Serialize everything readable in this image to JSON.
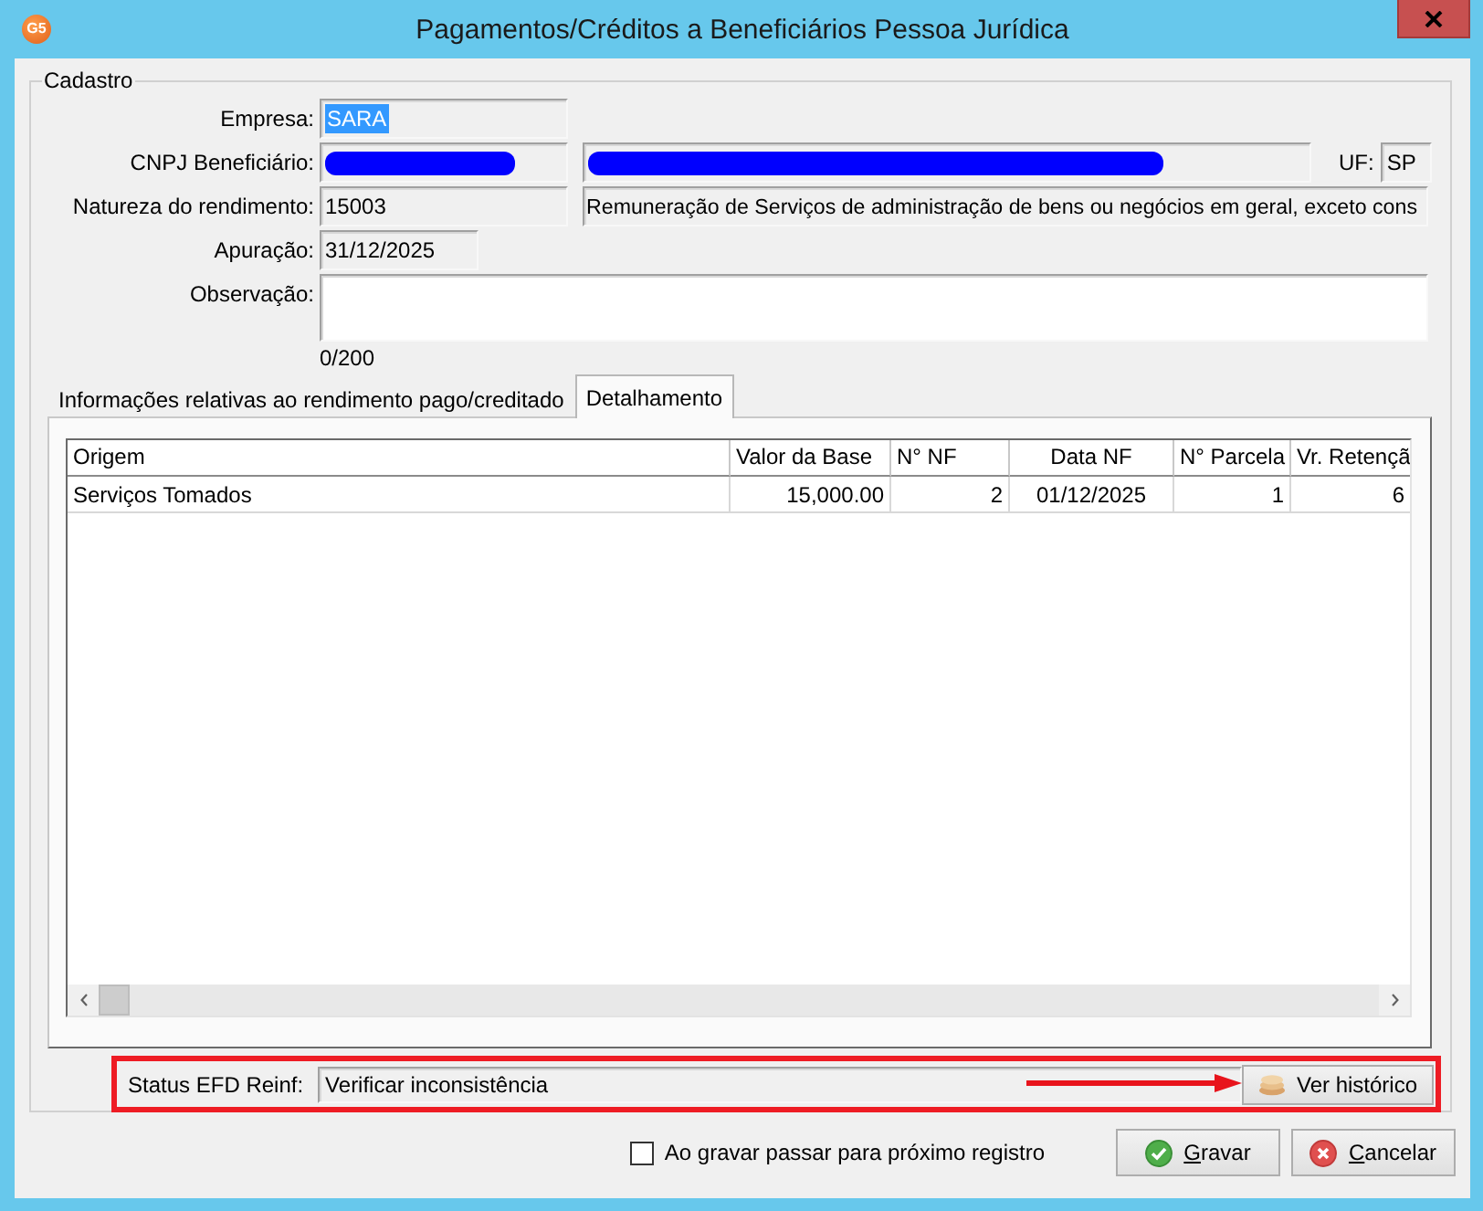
{
  "window": {
    "title": "Pagamentos/Créditos a Beneficiários Pessoa Jurídica",
    "icon_label": "G5"
  },
  "cadastro": {
    "title": "Cadastro",
    "empresa": {
      "label": "Empresa:",
      "value": "SARA",
      "text_selected": true
    },
    "cnpj_beneficiario": {
      "label": "CNPJ Beneficiário:",
      "code_redacted": true,
      "name_redacted": true,
      "uf_label": "UF:",
      "uf": "SP"
    },
    "natureza_do_rendimento": {
      "label": "Natureza do rendimento:",
      "code": "15003",
      "description": "Remuneração de Serviços de administração de bens ou negócios em geral, exceto cons"
    },
    "apuracao": {
      "label": "Apuração:",
      "value": "31/12/2025"
    },
    "observacao": {
      "label": "Observação:",
      "counter": "0/200"
    }
  },
  "tabs": [
    {
      "label": "Informações relativas ao rendimento pago/creditado",
      "selected": false
    },
    {
      "label": "Detalhamento",
      "selected": true
    }
  ],
  "table": {
    "columns": [
      {
        "label": "Origem",
        "kind": "text"
      },
      {
        "label": "Valor da Base",
        "kind": "number"
      },
      {
        "label": "N° NF",
        "kind": "number"
      },
      {
        "label": "Data NF",
        "kind": "date"
      },
      {
        "label": "N° Parcela",
        "kind": "number"
      },
      {
        "label": "Vr. Retençã",
        "kind": "number"
      }
    ],
    "rows": [
      [
        "Serviços Tomados",
        "15,000.00",
        "2",
        "01/12/2025",
        "1",
        "6"
      ]
    ]
  },
  "status_efd_reinf": {
    "label": "Status EFD Reinf:",
    "value": "Verificar inconsistência",
    "highlighted": true,
    "button": "Ver histórico"
  },
  "footer": {
    "checkbox": {
      "label": "Ao gravar passar para próximo registro",
      "checked": false
    },
    "buttons": [
      {
        "label": "Gravar",
        "kind": "save"
      },
      {
        "label": "Cancelar",
        "kind": "cancel"
      }
    ]
  }
}
